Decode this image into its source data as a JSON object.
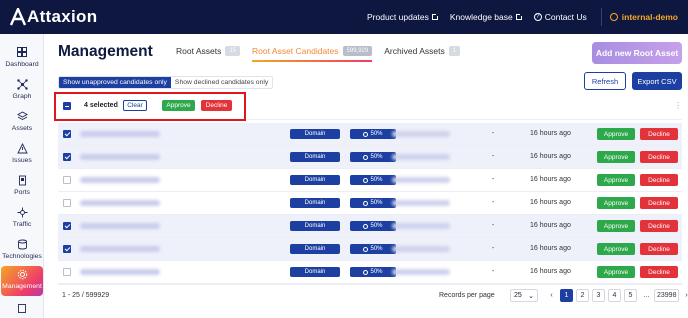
{
  "topbar": {
    "brand": "Attaxion",
    "links": [
      {
        "label": "Product updates",
        "icon": "external-link-icon"
      },
      {
        "label": "Knowledge base",
        "icon": "external-link-icon"
      },
      {
        "label": "Contact Us",
        "icon": "help-circle-icon"
      }
    ],
    "tenant": "internal-demo"
  },
  "sidebar": {
    "items": [
      {
        "label": "Dashboard",
        "icon": "dashboard-icon"
      },
      {
        "label": "Graph",
        "icon": "graph-icon"
      },
      {
        "label": "Assets",
        "icon": "assets-icon"
      },
      {
        "label": "Issues",
        "icon": "warning-icon"
      },
      {
        "label": "Ports",
        "icon": "ports-icon"
      },
      {
        "label": "Traffic",
        "icon": "traffic-icon"
      },
      {
        "label": "Technologies",
        "icon": "technologies-icon"
      },
      {
        "label": "Management",
        "icon": "gear-icon",
        "active": true
      }
    ]
  },
  "page": {
    "title": "Management",
    "tabs": [
      {
        "label": "Root Assets",
        "count": "15"
      },
      {
        "label": "Root Asset Candidates",
        "count": "599,929",
        "active": true
      },
      {
        "label": "Archived Assets",
        "count": "1"
      }
    ],
    "add_button": "Add new Root Asset",
    "filter": {
      "unapproved": "Show unapproved candidates only",
      "declined": "Show declined candidates only"
    },
    "refresh": "Refresh",
    "export": "Export CSV"
  },
  "selection": {
    "count_label": "4 selected",
    "clear": "Clear",
    "approve": "Approve",
    "decline": "Decline"
  },
  "rows": [
    {
      "selected": true,
      "type": "Domain",
      "confidence": "50%",
      "col5": "-",
      "time": "16 hours ago",
      "approve": "Approve",
      "decline": "Decline"
    },
    {
      "selected": true,
      "type": "Domain",
      "confidence": "50%",
      "col5": "-",
      "time": "16 hours ago",
      "approve": "Approve",
      "decline": "Decline"
    },
    {
      "selected": false,
      "type": "Domain",
      "confidence": "50%",
      "col5": "-",
      "time": "16 hours ago",
      "approve": "Approve",
      "decline": "Decline"
    },
    {
      "selected": false,
      "type": "Domain",
      "confidence": "50%",
      "col5": "-",
      "time": "16 hours ago",
      "approve": "Approve",
      "decline": "Decline"
    },
    {
      "selected": true,
      "type": "Domain",
      "confidence": "50%",
      "col5": "-",
      "time": "16 hours ago",
      "approve": "Approve",
      "decline": "Decline"
    },
    {
      "selected": true,
      "type": "Domain",
      "confidence": "50%",
      "col5": "-",
      "time": "16 hours ago",
      "approve": "Approve",
      "decline": "Decline"
    },
    {
      "selected": false,
      "type": "Domain",
      "confidence": "50%",
      "col5": "-",
      "time": "16 hours ago",
      "approve": "Approve",
      "decline": "Decline"
    }
  ],
  "footer": {
    "range": "1 - 25 / 599929",
    "records_label": "Records per page",
    "records_value": "25",
    "pages": [
      "1",
      "2",
      "3",
      "4",
      "5"
    ],
    "ellipsis": "...",
    "last_page": "23998",
    "current_page": "1"
  },
  "colors": {
    "navy": "#0d1740",
    "primary": "#1c3fa1",
    "approve": "#2da84a",
    "decline": "#e2323a",
    "tenant": "#f7a823",
    "highlight": "#e0161e"
  }
}
